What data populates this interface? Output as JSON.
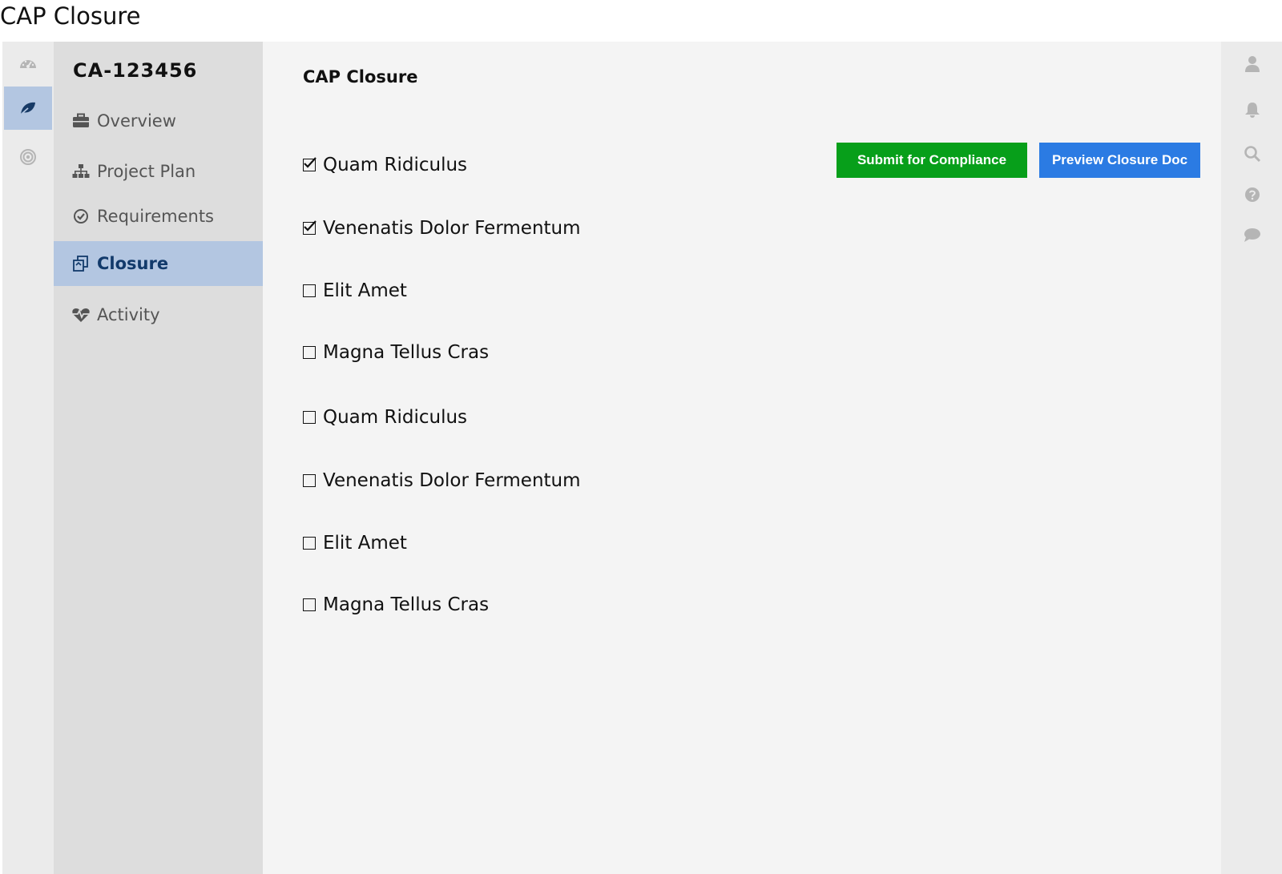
{
  "window": {
    "title": "CAP Closure"
  },
  "left_rail": {
    "icons": [
      "dashboard-icon",
      "leaf-icon",
      "target-icon"
    ]
  },
  "nav": {
    "record_id": "CA-123456",
    "items": [
      {
        "label": "Overview",
        "icon": "briefcase-icon"
      },
      {
        "label": "Project Plan",
        "icon": "sitemap-icon"
      },
      {
        "label": "Requirements",
        "icon": "check-circle-icon"
      },
      {
        "label": "Closure",
        "icon": "copy-icon",
        "active": true
      },
      {
        "label": "Activity",
        "icon": "heartbeat-icon"
      }
    ]
  },
  "main": {
    "title": "CAP Closure",
    "checklist": [
      {
        "label": "Quam Ridiculus",
        "checked": true
      },
      {
        "label": "Venenatis Dolor Fermentum",
        "checked": true
      },
      {
        "label": "Elit Amet",
        "checked": false
      },
      {
        "label": "Magna Tellus Cras",
        "checked": false
      },
      {
        "label": "Quam Ridiculus",
        "checked": false
      },
      {
        "label": "Venenatis Dolor Fermentum",
        "checked": false
      },
      {
        "label": "Elit Amet",
        "checked": false
      },
      {
        "label": "Magna Tellus Cras",
        "checked": false
      }
    ],
    "actions": {
      "submit_label": "Submit for Compliance",
      "preview_label": "Preview Closure Doc"
    }
  },
  "right_rail": {
    "icons": [
      "user-icon",
      "bell-icon",
      "search-icon",
      "help-icon",
      "chat-icon"
    ]
  },
  "colors": {
    "accent_nav": "#b3c6e1",
    "submit_green": "#079f1a",
    "preview_blue": "#2b7be3"
  }
}
